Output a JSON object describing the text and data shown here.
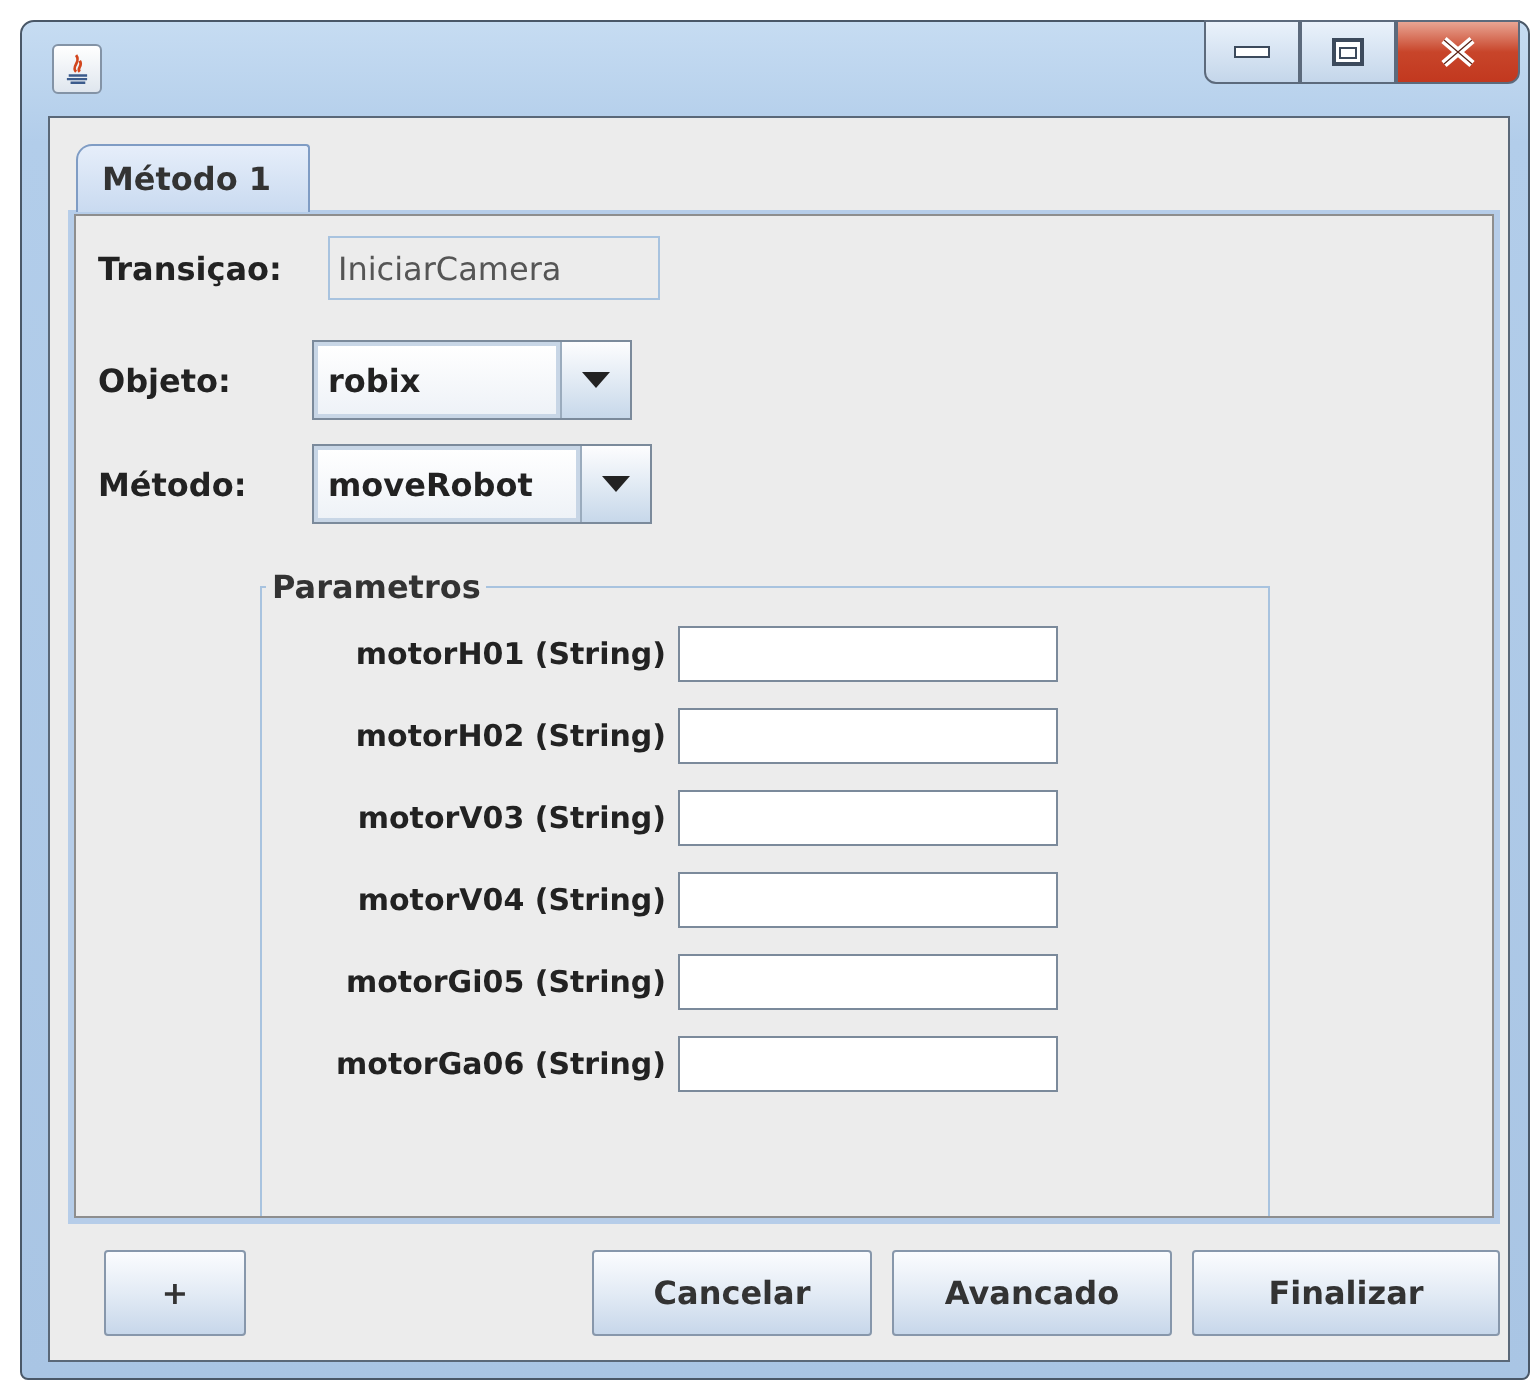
{
  "tabs": [
    {
      "label": "Método 1",
      "selected": true
    }
  ],
  "form": {
    "transition": {
      "label": "Transiçao:",
      "value": "IniciarCamera",
      "disabled": true
    },
    "object": {
      "label": "Objeto:",
      "value": "robix"
    },
    "method": {
      "label": "Método:",
      "value": "moveRobot"
    }
  },
  "parameters": {
    "title": "Parametros",
    "items": [
      {
        "label": "motorH01 (String)"
      },
      {
        "label": "motorH02 (String)"
      },
      {
        "label": "motorV03 (String)"
      },
      {
        "label": "motorV04 (String)"
      },
      {
        "label": "motorGi05 (String)"
      },
      {
        "label": "motorGa06 (String)"
      }
    ]
  },
  "buttons": [
    {
      "label": "+",
      "kind": "left"
    },
    {
      "label": "Cancelar",
      "kind": "right"
    },
    {
      "label": "Avancado",
      "kind": "right"
    },
    {
      "label": "Finalizar",
      "kind": "right"
    }
  ]
}
